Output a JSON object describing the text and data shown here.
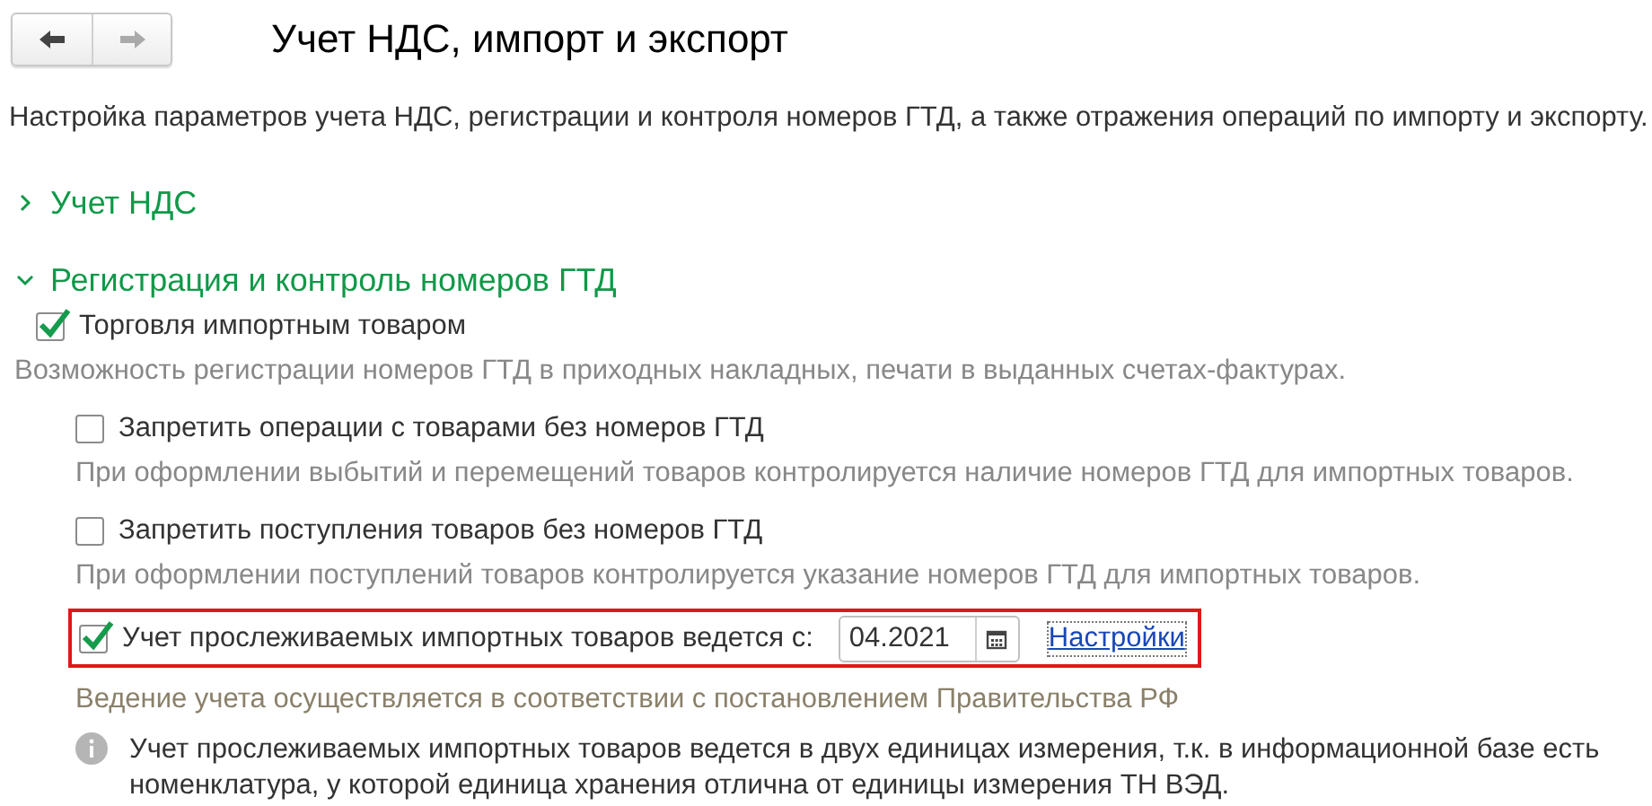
{
  "nav": {
    "back_enabled": true,
    "forward_enabled": false
  },
  "title": "Учет НДС, импорт и экспорт",
  "description": "Настройка параметров учета НДС, регистрации и контроля номеров ГТД, а также отражения операций по импорту и экспорту.",
  "sections": [
    {
      "title": "Учет НДС",
      "expanded": false
    },
    {
      "title": "Регистрация и контроль номеров ГТД",
      "expanded": true,
      "items": [
        {
          "kind": "checkbox",
          "label": "Торговля импортным товаром",
          "checked": true,
          "nested": false
        },
        {
          "kind": "hint",
          "text": "Возможность регистрации номеров ГТД в приходных накладных, печати в выданных счетах-фактурах.",
          "nested": false
        },
        {
          "kind": "checkbox",
          "label": "Запретить операции с товарами без номеров ГТД",
          "checked": false,
          "nested": true
        },
        {
          "kind": "hint",
          "text": "При оформлении выбытий и перемещений товаров контролируется наличие номеров ГТД для импортных товаров.",
          "nested": true
        },
        {
          "kind": "checkbox",
          "label": "Запретить поступления товаров без номеров ГТД",
          "checked": false,
          "nested": true
        },
        {
          "kind": "hint",
          "text": "При оформлении поступлений товаров контролируется указание номеров ГТД для импортных товаров.",
          "nested": true
        },
        {
          "kind": "date-checkbox",
          "label": "Учет прослеживаемых импортных товаров ведется с:",
          "checked": true,
          "nested": true,
          "highlighted": true,
          "date": "04.2021",
          "link": "Настройки"
        },
        {
          "kind": "note",
          "text": "Ведение учета осуществляется в соответствии с постановлением Правительства РФ",
          "nested": true
        },
        {
          "kind": "info",
          "text": "Учет прослеживаемых импортных товаров ведется в двух единицах измерения, т.к. в информационной базе есть номенклатура, у которой единица хранения отлична от единицы измерения ТН ВЭД.",
          "nested": true
        }
      ]
    }
  ]
}
